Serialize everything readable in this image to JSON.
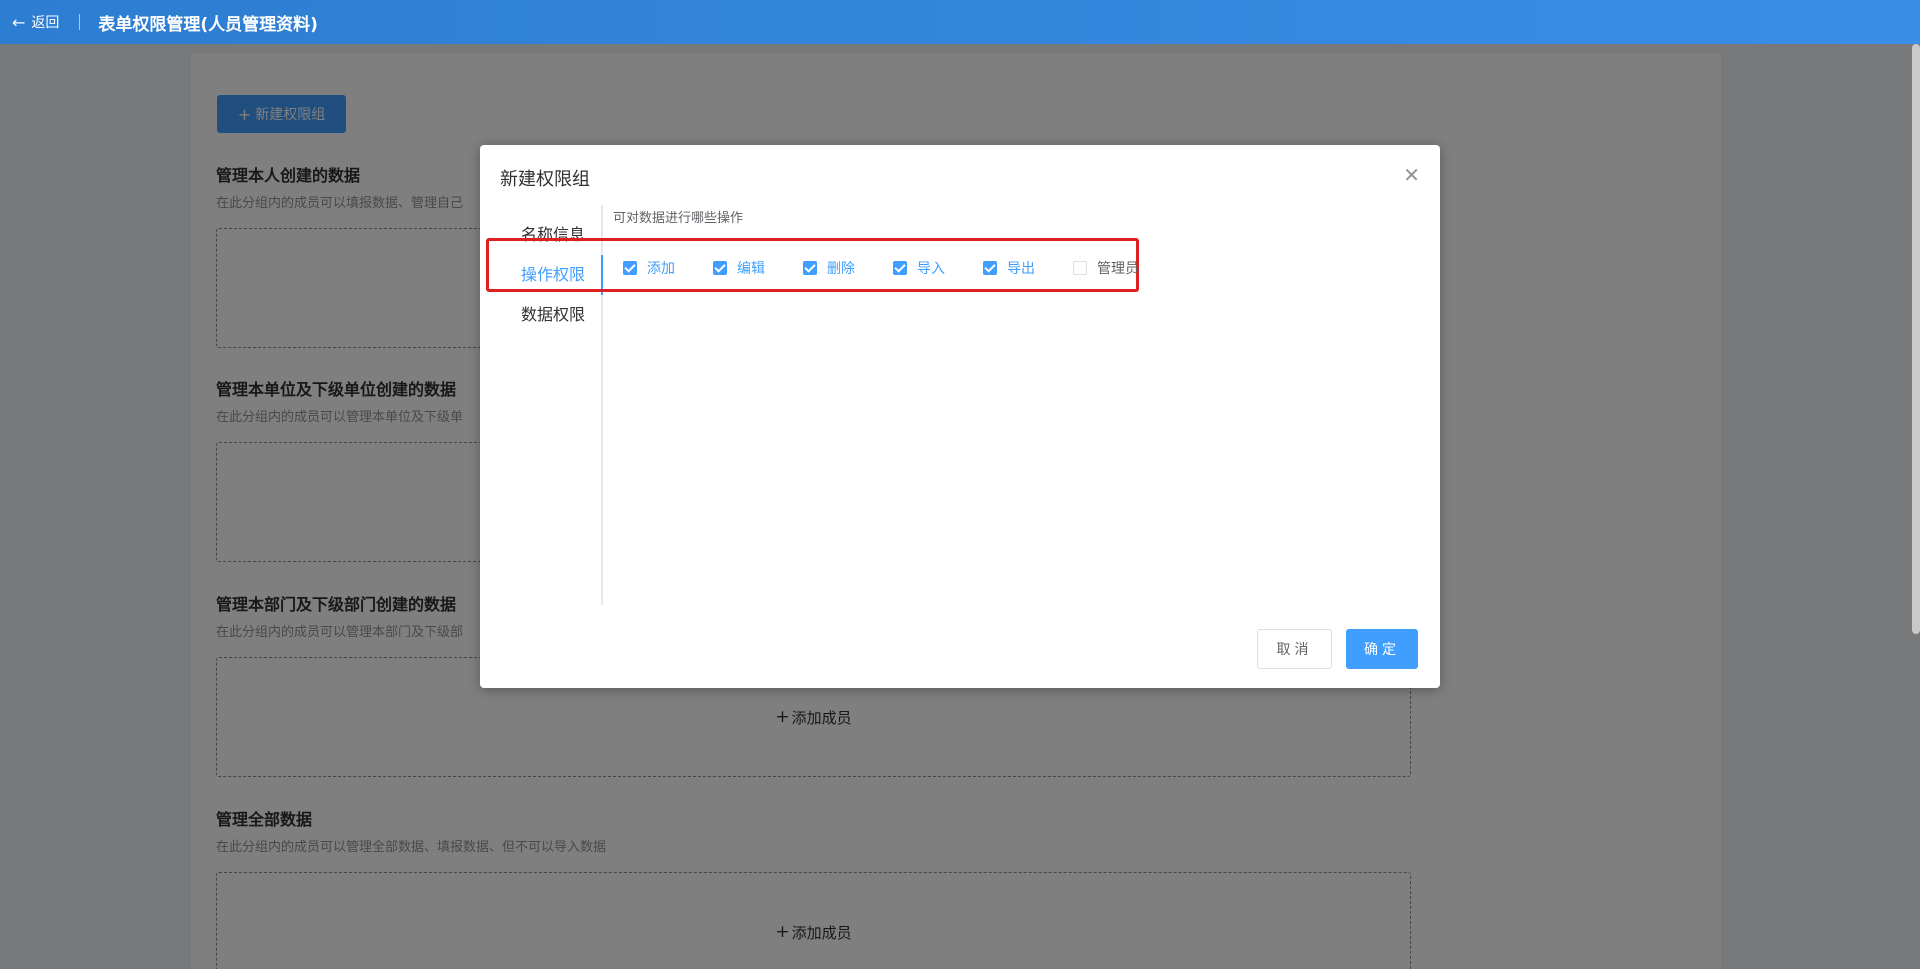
{
  "header": {
    "back_label": "返回",
    "title": "表单权限管理(人员管理资料)"
  },
  "page": {
    "new_group_label": "新建权限组",
    "sections": [
      {
        "title": "管理本人创建的数据",
        "desc": "在此分组内的成员可以填报数据、管理自己"
      },
      {
        "title": "管理本单位及下级单位创建的数据",
        "desc": "在此分组内的成员可以管理本单位及下级单"
      },
      {
        "title": "管理本部门及下级部门创建的数据",
        "desc": "在此分组内的成员可以管理本部门及下级部"
      },
      {
        "title": "管理全部数据",
        "desc": "在此分组内的成员可以管理全部数据、填报数据、但不可以导入数据"
      }
    ],
    "add_member_label": "添加成员"
  },
  "dialog": {
    "title": "新建权限组",
    "nav": [
      "名称信息",
      "操作权限",
      "数据权限"
    ],
    "hint": "可对数据进行哪些操作",
    "permissions": [
      {
        "label": "添加",
        "checked": true
      },
      {
        "label": "编辑",
        "checked": true
      },
      {
        "label": "删除",
        "checked": true
      },
      {
        "label": "导入",
        "checked": true
      },
      {
        "label": "导出",
        "checked": true
      },
      {
        "label": "管理员",
        "checked": false
      }
    ],
    "cancel_label": "取消",
    "confirm_label": "确定"
  },
  "colors": {
    "accent": "#409eff",
    "header": "#2d7dd2",
    "highlight": "#e02020"
  }
}
